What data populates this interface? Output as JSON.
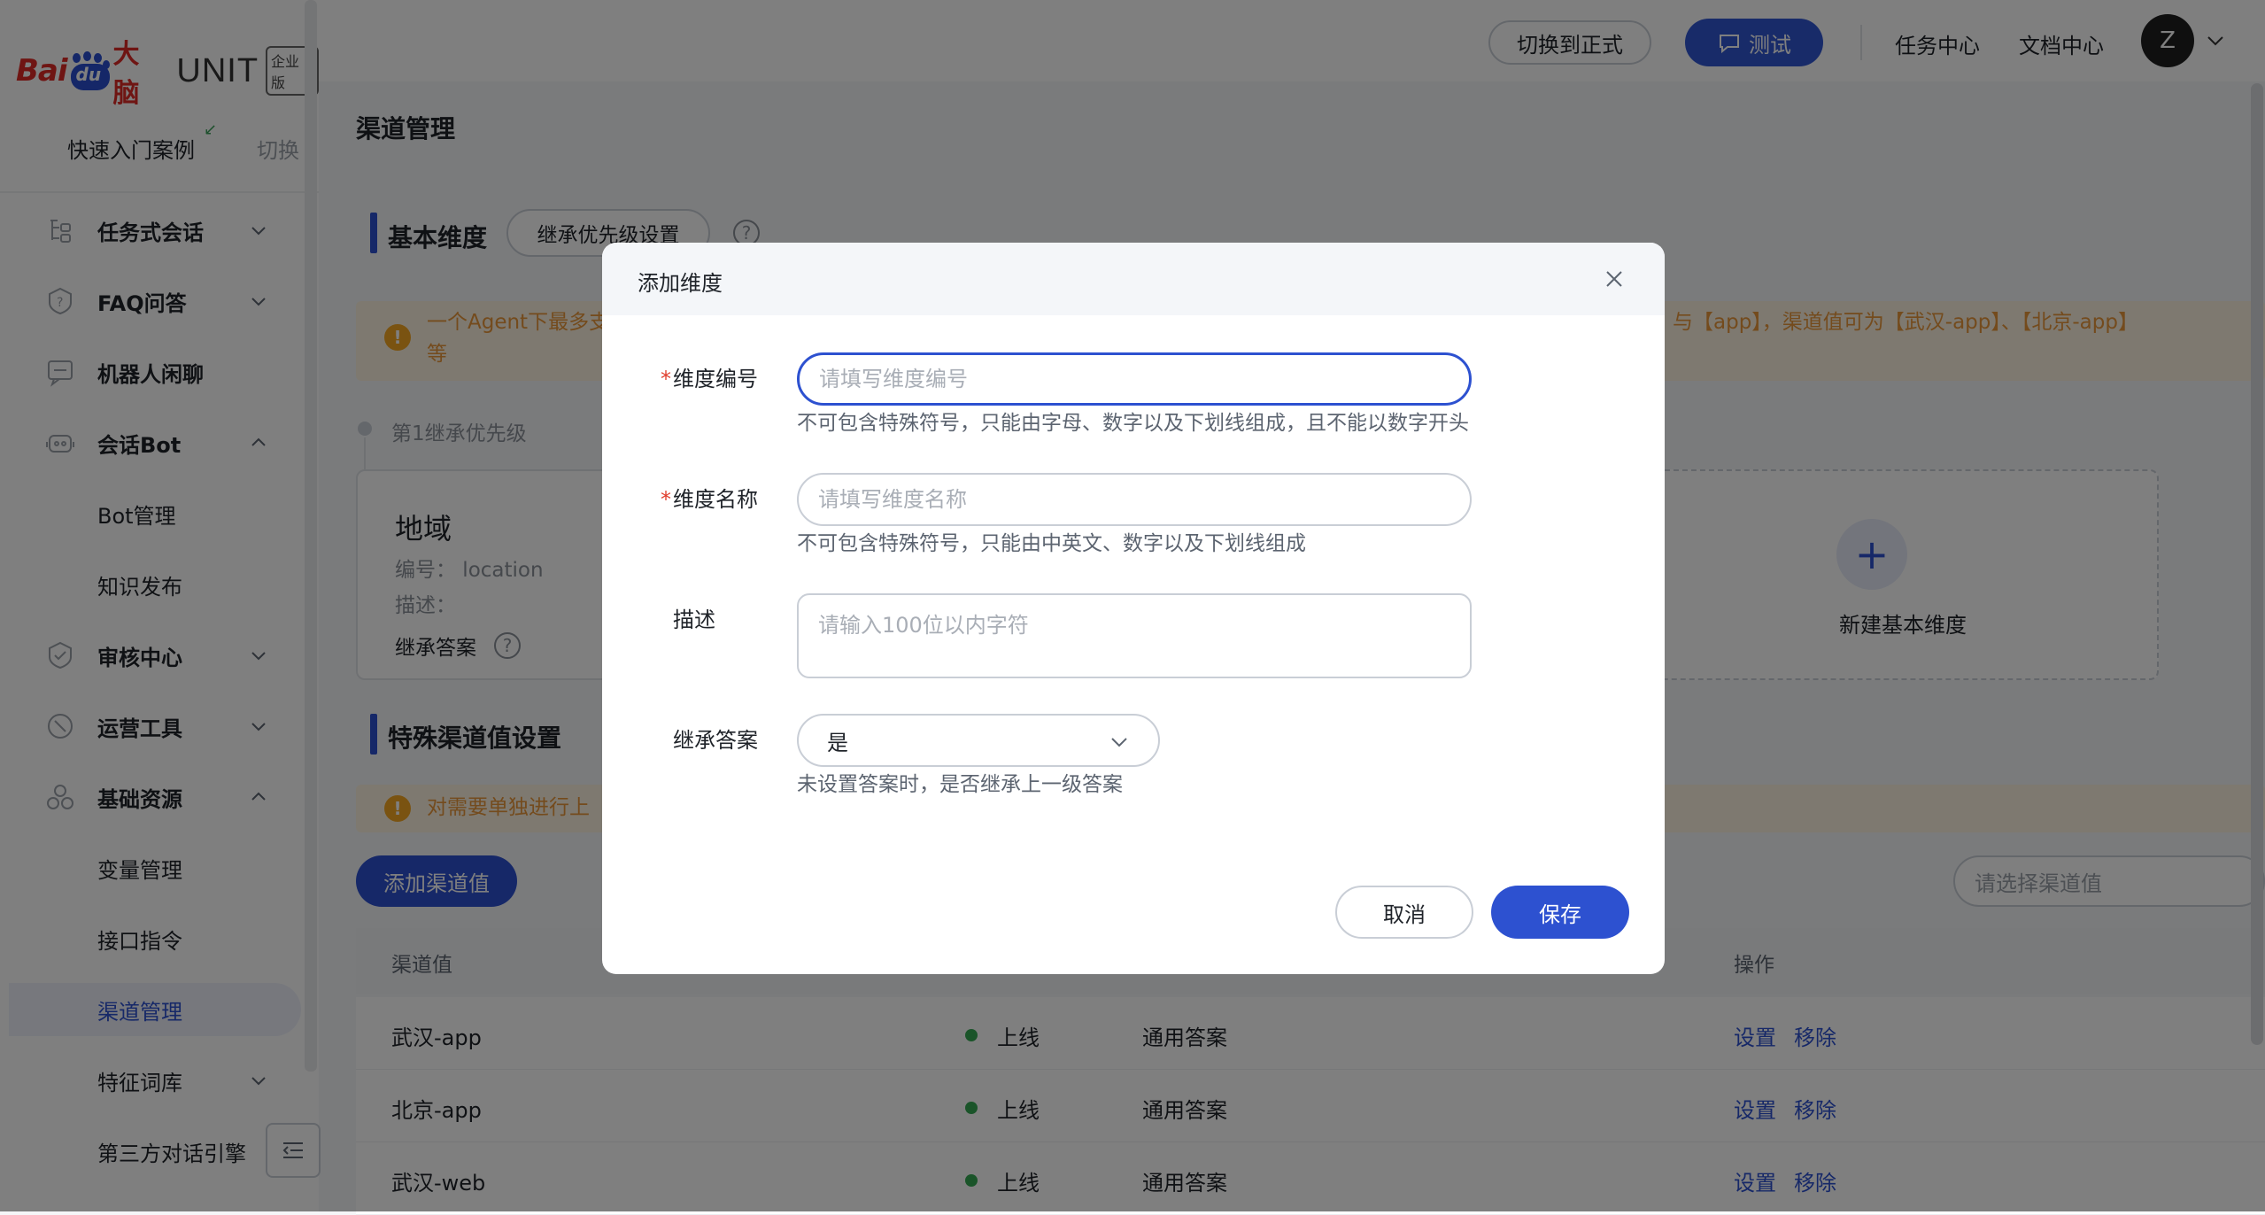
{
  "brand": {
    "bai": "Bai",
    "du": "du",
    "danao": "大脑",
    "unit": "UNIT",
    "badge": "企业版"
  },
  "sidebar": {
    "quick_start": "快速入门案例",
    "switch_label": "切换",
    "items": [
      {
        "label": "任务式会话",
        "icon": "task-flow-icon",
        "expanded": false
      },
      {
        "label": "FAQ问答",
        "icon": "faq-shield-icon",
        "expanded": false
      },
      {
        "label": "机器人闲聊",
        "icon": "chat-bubble-icon"
      },
      {
        "label": "会话Bot",
        "icon": "bot-icon",
        "expanded": true
      },
      {
        "label": "Bot管理"
      },
      {
        "label": "知识发布"
      },
      {
        "label": "审核中心",
        "icon": "audit-shield-icon",
        "expanded": false
      },
      {
        "label": "运营工具",
        "icon": "ops-tool-icon",
        "expanded": false
      },
      {
        "label": "基础资源",
        "icon": "resource-icon",
        "expanded": true
      },
      {
        "label": "变量管理"
      },
      {
        "label": "接口指令"
      },
      {
        "label": "渠道管理",
        "active": true
      },
      {
        "label": "特征词库",
        "expanded": false
      },
      {
        "label": "第三方对话引擎"
      }
    ]
  },
  "topbar": {
    "switch_button": "切换到正式",
    "test_button": "测试",
    "task_center": "任务中心",
    "doc_center": "文档中心",
    "avatar_letter": "Z"
  },
  "page": {
    "title": "渠道管理",
    "basic_section": {
      "title": "基本维度",
      "inherit_button": "继承优先级设置",
      "warning_left": "一个Agent下最多支",
      "warning_right": "】与【app】，渠道值可为【武汉-app】、【北京-app】",
      "warning_tail": "等",
      "priority_label": "第1继承优先级",
      "dimension_card": {
        "title": "地域",
        "code_line": "编号： location",
        "desc_line": "描述：",
        "inherit_line": "继承答案"
      },
      "new_dimension_label": "新建基本维度"
    },
    "special_section": {
      "title": "特殊渠道值设置",
      "warning": "对需要单独进行上",
      "add_button": "添加渠道值",
      "select_placeholder": "请选择渠道值"
    },
    "table": {
      "columns": [
        "渠道值",
        "操作"
      ],
      "rows": [
        {
          "channel": "武汉-app",
          "status": "上线",
          "answer": "通用答案",
          "ops": [
            "设置",
            "移除"
          ]
        },
        {
          "channel": "北京-app",
          "status": "上线",
          "answer": "通用答案",
          "ops": [
            "设置",
            "移除"
          ]
        },
        {
          "channel": "武汉-web",
          "status": "上线",
          "answer": "通用答案",
          "ops": [
            "设置",
            "移除"
          ]
        }
      ]
    }
  },
  "modal": {
    "title": "添加维度",
    "fields": {
      "code": {
        "label": "维度编号",
        "required": true,
        "placeholder": "请填写维度编号",
        "value": "",
        "hint": "不可包含特殊符号，只能由字母、数字以及下划线组成，且不能以数字开头"
      },
      "name": {
        "label": "维度名称",
        "required": true,
        "placeholder": "请填写维度名称",
        "value": "",
        "hint": "不可包含特殊符号，只能由中英文、数字以及下划线组成"
      },
      "desc": {
        "label": "描述",
        "placeholder": "请输入100位以内字符",
        "value": ""
      },
      "inherit": {
        "label": "继承答案",
        "value": "是",
        "hint": "未设置答案时，是否继承上一级答案"
      }
    },
    "cancel_button": "取消",
    "save_button": "保存"
  },
  "colors": {
    "primary": "#2d51d0",
    "warning": "#f5a623",
    "online": "#34a853",
    "brand_red": "#de2b27"
  }
}
